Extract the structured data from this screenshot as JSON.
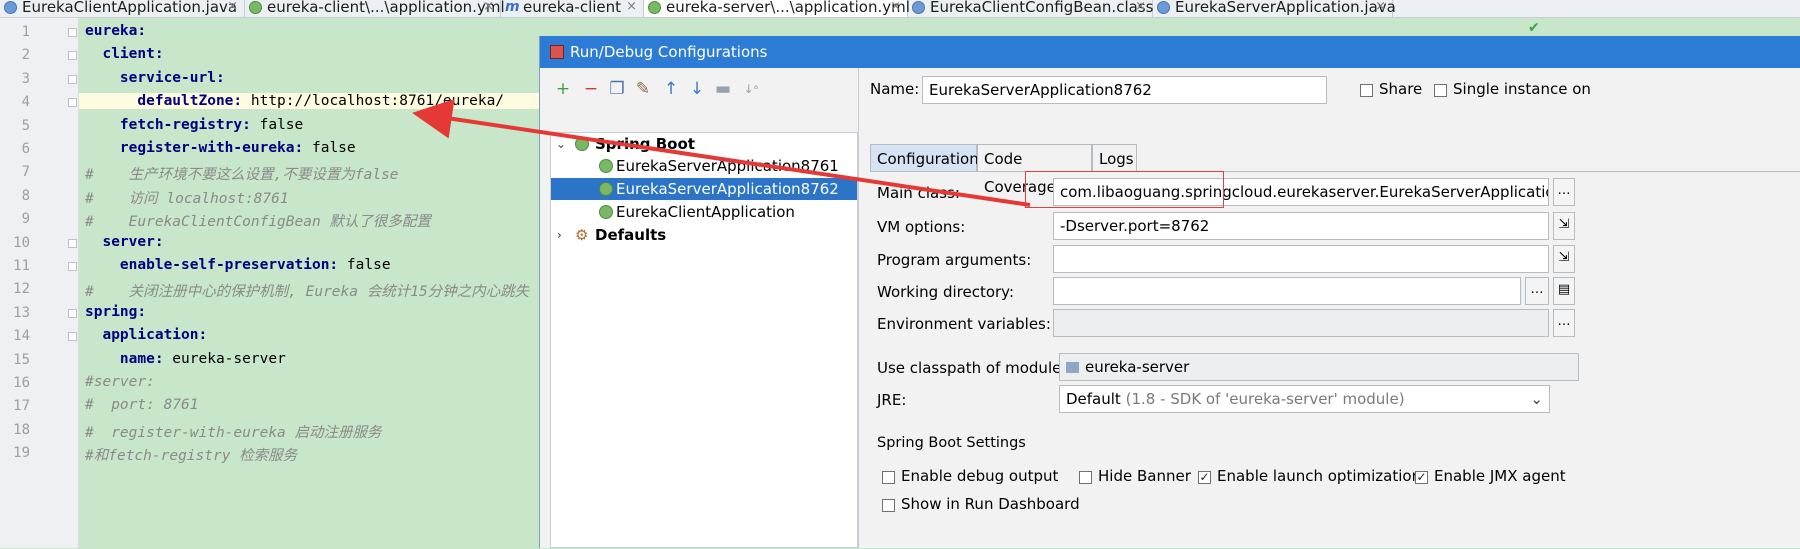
{
  "editor_tabs": [
    {
      "label": "EurekaClientApplication.java",
      "icon": "class-icon"
    },
    {
      "label": "eureka-client\\...\\application.yml",
      "icon": "spring-yml-icon"
    },
    {
      "label": "eureka-client",
      "icon": "maven-icon"
    },
    {
      "label": "eureka-server\\...\\application.yml",
      "icon": "spring-yml-icon"
    },
    {
      "label": "EurekaClientConfigBean.class",
      "icon": "class-icon"
    },
    {
      "label": "EurekaServerApplication.java",
      "icon": "class-icon"
    }
  ],
  "code_lines": [
    {
      "n": "1",
      "k": "eureka:",
      "v": ""
    },
    {
      "n": "2",
      "k": "  client:",
      "v": ""
    },
    {
      "n": "3",
      "k": "    service-url:",
      "v": ""
    },
    {
      "n": "4",
      "k": "      defaultZone:",
      "v": " http://localhost:8761/eureka/"
    },
    {
      "n": "5",
      "k": "    fetch-registry:",
      "v": " false"
    },
    {
      "n": "6",
      "k": "    register-with-eureka:",
      "v": " false"
    },
    {
      "n": "7",
      "c": "#    生产环境不要这么设置,不要设置为false"
    },
    {
      "n": "8",
      "c": "#    访问 localhost:8761"
    },
    {
      "n": "9",
      "c": "#    EurekaClientConfigBean 默认了很多配置"
    },
    {
      "n": "10",
      "k": "  server:",
      "v": ""
    },
    {
      "n": "11",
      "k": "    enable-self-preservation:",
      "v": " false"
    },
    {
      "n": "12",
      "c": "#    关闭注册中心的保护机制, Eureka 会统计15分钟之内心跳失"
    },
    {
      "n": "13",
      "k": "spring:",
      "v": ""
    },
    {
      "n": "14",
      "k": "  application:",
      "v": ""
    },
    {
      "n": "15",
      "k": "    name:",
      "v": " eureka-server"
    },
    {
      "n": "16",
      "c": "#server:"
    },
    {
      "n": "17",
      "c": "#  port: 8761"
    },
    {
      "n": "18",
      "c": "#  register-with-eureka 启动注册服务"
    },
    {
      "n": "19",
      "c": "#和fetch-registry 检索服务"
    }
  ],
  "dialog": {
    "title": "Run/Debug Configurations",
    "tree": {
      "group": "Spring Boot",
      "items": [
        "EurekaServerApplication8761",
        "EurekaServerApplication8762",
        "EurekaClientApplication"
      ],
      "selected": "EurekaServerApplication8762",
      "defaults": "Defaults"
    },
    "name_label": "Name:",
    "name_value": "EurekaServerApplication8762",
    "share_label": "Share",
    "single_instance_label": "Single instance on",
    "tabs": [
      "Configuration",
      "Code Coverage",
      "Logs"
    ],
    "main_class_label": "Main class:",
    "main_class_value": "com.libaoguang.springcloud.eurekaserver.EurekaServerApplication",
    "vm_options_label": "VM options:",
    "vm_options_value": "-Dserver.port=8762",
    "program_args_label": "Program arguments:",
    "working_dir_label": "Working directory:",
    "env_vars_label": "Environment variables:",
    "classpath_label": "Use classpath of module:",
    "classpath_value": "eureka-server",
    "jre_label": "JRE:",
    "jre_value": "Default",
    "jre_detail": "(1.8 - SDK of 'eureka-server' module)",
    "spring_boot_settings": "Spring Boot Settings",
    "checkboxes": [
      {
        "label": "Enable debug output",
        "checked": false
      },
      {
        "label": "Hide Banner",
        "checked": false
      },
      {
        "label": "Enable launch optimization",
        "checked": true
      },
      {
        "label": "Enable JMX agent",
        "checked": true
      },
      {
        "label": "Show in Run Dashboard",
        "checked": false
      }
    ]
  },
  "annotation_color": "#e53935"
}
